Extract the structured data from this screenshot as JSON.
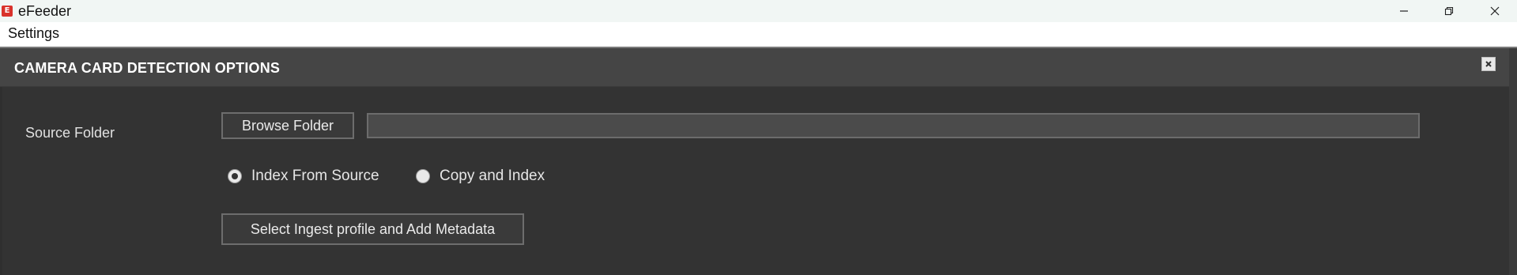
{
  "window": {
    "app_icon_letter": "E",
    "title": "eFeeder",
    "controls": [
      "minimize",
      "restore",
      "close"
    ]
  },
  "menubar": {
    "items": [
      "Settings"
    ]
  },
  "panel": {
    "title": "CAMERA CARD DETECTION OPTIONS",
    "source_folder_label": "Source Folder",
    "browse_button_label": "Browse Folder",
    "path_value": "",
    "radio_options": [
      {
        "label": "Index From Source",
        "selected": true
      },
      {
        "label": "Copy and Index",
        "selected": false
      }
    ],
    "ingest_button_label": "Select Ingest profile and Add Metadata"
  },
  "icons": {
    "app": "efeeder-logo-icon",
    "minimize": "minimize-icon",
    "restore": "restore-icon",
    "close": "close-icon",
    "panel_close": "panel-close-icon"
  },
  "colors": {
    "panel_background": "#333333",
    "panel_header": "#454545",
    "app_icon": "#d9322b"
  }
}
